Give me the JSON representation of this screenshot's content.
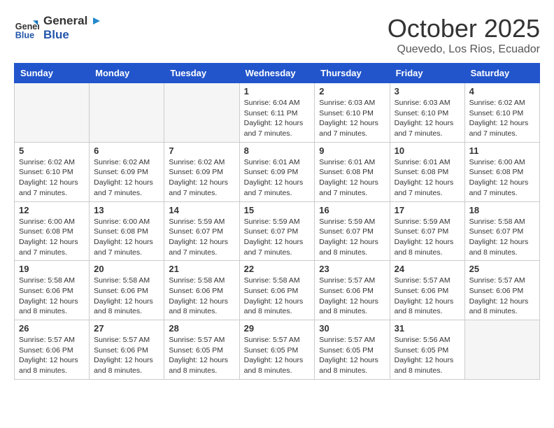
{
  "logo": {
    "line1": "General",
    "line2": "Blue"
  },
  "title": "October 2025",
  "subtitle": "Quevedo, Los Rios, Ecuador",
  "days_of_week": [
    "Sunday",
    "Monday",
    "Tuesday",
    "Wednesday",
    "Thursday",
    "Friday",
    "Saturday"
  ],
  "weeks": [
    [
      {
        "num": "",
        "info": ""
      },
      {
        "num": "",
        "info": ""
      },
      {
        "num": "",
        "info": ""
      },
      {
        "num": "1",
        "info": "Sunrise: 6:04 AM\nSunset: 6:11 PM\nDaylight: 12 hours and 7 minutes."
      },
      {
        "num": "2",
        "info": "Sunrise: 6:03 AM\nSunset: 6:10 PM\nDaylight: 12 hours and 7 minutes."
      },
      {
        "num": "3",
        "info": "Sunrise: 6:03 AM\nSunset: 6:10 PM\nDaylight: 12 hours and 7 minutes."
      },
      {
        "num": "4",
        "info": "Sunrise: 6:02 AM\nSunset: 6:10 PM\nDaylight: 12 hours and 7 minutes."
      }
    ],
    [
      {
        "num": "5",
        "info": "Sunrise: 6:02 AM\nSunset: 6:10 PM\nDaylight: 12 hours and 7 minutes."
      },
      {
        "num": "6",
        "info": "Sunrise: 6:02 AM\nSunset: 6:09 PM\nDaylight: 12 hours and 7 minutes."
      },
      {
        "num": "7",
        "info": "Sunrise: 6:02 AM\nSunset: 6:09 PM\nDaylight: 12 hours and 7 minutes."
      },
      {
        "num": "8",
        "info": "Sunrise: 6:01 AM\nSunset: 6:09 PM\nDaylight: 12 hours and 7 minutes."
      },
      {
        "num": "9",
        "info": "Sunrise: 6:01 AM\nSunset: 6:08 PM\nDaylight: 12 hours and 7 minutes."
      },
      {
        "num": "10",
        "info": "Sunrise: 6:01 AM\nSunset: 6:08 PM\nDaylight: 12 hours and 7 minutes."
      },
      {
        "num": "11",
        "info": "Sunrise: 6:00 AM\nSunset: 6:08 PM\nDaylight: 12 hours and 7 minutes."
      }
    ],
    [
      {
        "num": "12",
        "info": "Sunrise: 6:00 AM\nSunset: 6:08 PM\nDaylight: 12 hours and 7 minutes."
      },
      {
        "num": "13",
        "info": "Sunrise: 6:00 AM\nSunset: 6:08 PM\nDaylight: 12 hours and 7 minutes."
      },
      {
        "num": "14",
        "info": "Sunrise: 5:59 AM\nSunset: 6:07 PM\nDaylight: 12 hours and 7 minutes."
      },
      {
        "num": "15",
        "info": "Sunrise: 5:59 AM\nSunset: 6:07 PM\nDaylight: 12 hours and 7 minutes."
      },
      {
        "num": "16",
        "info": "Sunrise: 5:59 AM\nSunset: 6:07 PM\nDaylight: 12 hours and 8 minutes."
      },
      {
        "num": "17",
        "info": "Sunrise: 5:59 AM\nSunset: 6:07 PM\nDaylight: 12 hours and 8 minutes."
      },
      {
        "num": "18",
        "info": "Sunrise: 5:58 AM\nSunset: 6:07 PM\nDaylight: 12 hours and 8 minutes."
      }
    ],
    [
      {
        "num": "19",
        "info": "Sunrise: 5:58 AM\nSunset: 6:06 PM\nDaylight: 12 hours and 8 minutes."
      },
      {
        "num": "20",
        "info": "Sunrise: 5:58 AM\nSunset: 6:06 PM\nDaylight: 12 hours and 8 minutes."
      },
      {
        "num": "21",
        "info": "Sunrise: 5:58 AM\nSunset: 6:06 PM\nDaylight: 12 hours and 8 minutes."
      },
      {
        "num": "22",
        "info": "Sunrise: 5:58 AM\nSunset: 6:06 PM\nDaylight: 12 hours and 8 minutes."
      },
      {
        "num": "23",
        "info": "Sunrise: 5:57 AM\nSunset: 6:06 PM\nDaylight: 12 hours and 8 minutes."
      },
      {
        "num": "24",
        "info": "Sunrise: 5:57 AM\nSunset: 6:06 PM\nDaylight: 12 hours and 8 minutes."
      },
      {
        "num": "25",
        "info": "Sunrise: 5:57 AM\nSunset: 6:06 PM\nDaylight: 12 hours and 8 minutes."
      }
    ],
    [
      {
        "num": "26",
        "info": "Sunrise: 5:57 AM\nSunset: 6:06 PM\nDaylight: 12 hours and 8 minutes."
      },
      {
        "num": "27",
        "info": "Sunrise: 5:57 AM\nSunset: 6:06 PM\nDaylight: 12 hours and 8 minutes."
      },
      {
        "num": "28",
        "info": "Sunrise: 5:57 AM\nSunset: 6:05 PM\nDaylight: 12 hours and 8 minutes."
      },
      {
        "num": "29",
        "info": "Sunrise: 5:57 AM\nSunset: 6:05 PM\nDaylight: 12 hours and 8 minutes."
      },
      {
        "num": "30",
        "info": "Sunrise: 5:57 AM\nSunset: 6:05 PM\nDaylight: 12 hours and 8 minutes."
      },
      {
        "num": "31",
        "info": "Sunrise: 5:56 AM\nSunset: 6:05 PM\nDaylight: 12 hours and 8 minutes."
      },
      {
        "num": "",
        "info": ""
      }
    ]
  ]
}
